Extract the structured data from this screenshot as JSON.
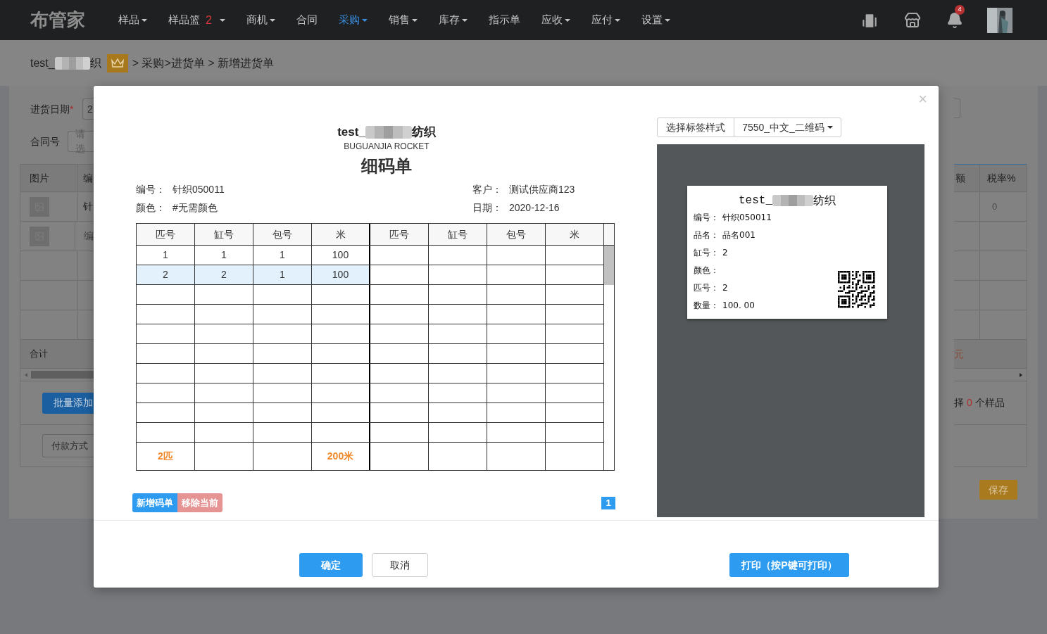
{
  "header": {
    "logo": "布管家",
    "nav": [
      {
        "label": "样品",
        "dropdown": true,
        "selected": false
      },
      {
        "label": "样品篮",
        "badge": "2",
        "dropdown": true,
        "selected": false
      },
      {
        "label": "商机",
        "dropdown": true,
        "selected": false
      },
      {
        "label": "合同",
        "dropdown": false,
        "selected": false
      },
      {
        "label": "采购",
        "dropdown": true,
        "selected": true
      },
      {
        "label": "销售",
        "dropdown": true,
        "selected": false
      },
      {
        "label": "库存",
        "dropdown": true,
        "selected": false
      },
      {
        "label": "指示单",
        "dropdown": false,
        "selected": false
      },
      {
        "label": "应收",
        "dropdown": true,
        "selected": false
      },
      {
        "label": "应付",
        "dropdown": true,
        "selected": false
      },
      {
        "label": "设置",
        "dropdown": true,
        "selected": false
      }
    ],
    "notification_count": "4"
  },
  "breadcrumb": {
    "company_prefix": "test_",
    "company_suffix": "织",
    "path": "> 采购>进货单 > 新增进货单"
  },
  "purchase_form": {
    "fields": [
      {
        "label": "进货日期",
        "required_marker": "*",
        "value": "2"
      },
      {
        "label": "合同号",
        "placeholder": "请选"
      }
    ],
    "table": {
      "left_columns": [
        "图片",
        "编"
      ],
      "right_columns": [
        "额",
        "税率%"
      ],
      "rows": [
        {
          "has_image": true,
          "code": "针",
          "tax_rate": "0"
        },
        {
          "has_image": true,
          "code": "编"
        },
        {
          "has_image": false
        },
        {
          "has_image": false
        },
        {
          "has_image": false
        }
      ],
      "total_label": "合计",
      "total_value": "元"
    },
    "batch_add_button": "批量添加",
    "selection_note": {
      "prefix": "择",
      "count": "0",
      "suffix": "个样品"
    },
    "payment_button": "付款方式",
    "save_button": "保存"
  },
  "modal": {
    "close": "×",
    "document": {
      "company_prefix": "test_",
      "company_suffix": "纺织",
      "subtitle": "BUGUANJIA ROCKET",
      "title": "细码单",
      "info_left": [
        {
          "label": "编号：",
          "value": "针织050011"
        },
        {
          "label": "颜色：",
          "value": "#无需颜色"
        }
      ],
      "info_right": [
        {
          "label": "客户：",
          "value": "测试供应商123"
        },
        {
          "label": "日期：",
          "value": "2020-12-16"
        }
      ],
      "columns": [
        "匹号",
        "缸号",
        "包号",
        "米",
        "匹号",
        "缸号",
        "包号",
        "米"
      ],
      "rows": [
        {
          "cells": [
            "1",
            "1",
            "1",
            "100"
          ],
          "selected": false
        },
        {
          "cells": [
            "2",
            "2",
            "1",
            "100"
          ],
          "selected": true
        }
      ],
      "totals": {
        "pieces": "2匹",
        "meters": "200米"
      },
      "add_button": "新增码单",
      "remove_button": "移除当前",
      "pages": [
        {
          "label": "1",
          "selected": true
        }
      ]
    },
    "label_style": {
      "button": "选择标签样式",
      "value": "7550_中文_二维码"
    },
    "label_preview": {
      "company_prefix": "test_",
      "company_suffix": "纺织",
      "fields": [
        {
          "label": "编号：",
          "value": "针织050011"
        },
        {
          "label": "品名：",
          "value": "品名001"
        },
        {
          "label": "缸号：",
          "value": "2"
        },
        {
          "label": "颜色："
        },
        {
          "label": "匹号：",
          "value": "2"
        },
        {
          "label": "数量：",
          "value": "100. 00"
        }
      ]
    },
    "footer": {
      "confirm": "确定",
      "cancel": "取消",
      "print": "打印（按P键可打印）"
    }
  }
}
